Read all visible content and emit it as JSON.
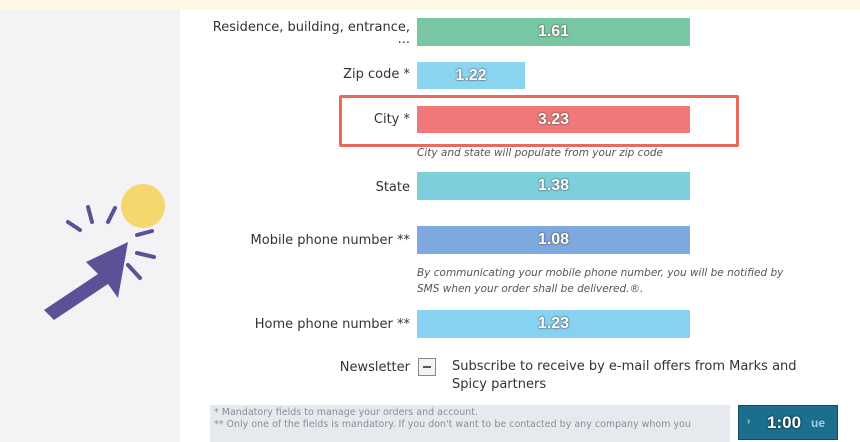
{
  "form": {
    "rows": [
      {
        "label": "Residence, building, entrance,",
        "label2": "...",
        "value": "1.61",
        "color": "#78c8a2"
      },
      {
        "label": "Zip code *",
        "value": "1.22",
        "color": "#8ad6f0"
      },
      {
        "label": "City *",
        "value": "3.23",
        "color": "#f07878"
      },
      {
        "label": "State",
        "value": "1.38",
        "color": "#7ecfdc"
      },
      {
        "label": "Mobile phone number **",
        "value": "1.08",
        "color": "#7ea8e0"
      },
      {
        "label": "Home phone number **",
        "value": "1.23",
        "color": "#87d2f0"
      }
    ],
    "city_hint": "City and state will populate from your zip code",
    "mobile_hint_1": "By communicating your mobile phone number, you will be notified by",
    "mobile_hint_2": "SMS when your order shall be delivered.®.",
    "newsletter_label": "Newsletter",
    "newsletter_text": "Subscribe to receive by e-mail offers from Marks and Spicy partners",
    "footer_line1": "* Mandatory fields to manage your orders and account.",
    "footer_line2": "** Only one of the fields is mandatory. If you don't want to be contacted by any company whom you"
  },
  "continue_button": {
    "label": "ue",
    "arrow": "›",
    "overlay_value": "1:00"
  },
  "colors": {
    "highlight": "#e86a5f",
    "cursor": "#5a5196",
    "cursor_glow": "#f5d76e"
  }
}
